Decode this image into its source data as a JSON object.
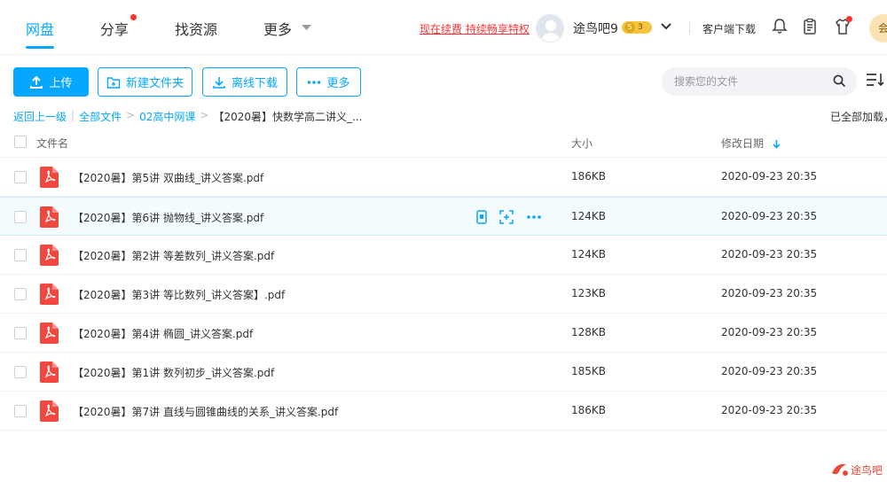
{
  "nav": {
    "tabs": [
      {
        "label": "网盘"
      },
      {
        "label": "分享"
      },
      {
        "label": "找资源"
      },
      {
        "label": "更多"
      }
    ],
    "renew_link": "现在续费 持续畅享特权",
    "username": "途鸟吧9",
    "level_badge": "5",
    "level_count": "3",
    "client_download": "客户端下载",
    "vip_initial": "会"
  },
  "toolbar": {
    "upload_label": "上传",
    "new_folder_label": "新建文件夹",
    "offline_download_label": "离线下载",
    "more_label": "更多",
    "search_placeholder": "搜索您的文件"
  },
  "breadcrumb": {
    "back": "返回上一级",
    "items": [
      "全部文件",
      "02高中网课",
      "【2020暑】快数学高二讲义_..."
    ],
    "status": "已全部加载，"
  },
  "table": {
    "columns": {
      "name": "文件名",
      "size": "大小",
      "modified": "修改日期"
    },
    "rows": [
      {
        "name": "【2020暑】第5讲 双曲线_讲义答案.pdf",
        "size": "186KB",
        "date": "2020-09-23 20:35"
      },
      {
        "name": "【2020暑】第6讲 抛物线_讲义答案.pdf",
        "size": "124KB",
        "date": "2020-09-23 20:35"
      },
      {
        "name": "【2020暑】第2讲 等差数列_讲义答案.pdf",
        "size": "124KB",
        "date": "2020-09-23 20:35"
      },
      {
        "name": "【2020暑】第3讲 等比数列_讲义答案】.pdf",
        "size": "123KB",
        "date": "2020-09-23 20:35"
      },
      {
        "name": "【2020暑】第4讲 椭圆_讲义答案.pdf",
        "size": "128KB",
        "date": "2020-09-23 20:35"
      },
      {
        "name": "【2020暑】第1讲 数列初步_讲义答案.pdf",
        "size": "185KB",
        "date": "2020-09-23 20:35"
      },
      {
        "name": "【2020暑】第7讲 直线与圆锥曲线的关系_讲义答案.pdf",
        "size": "186KB",
        "date": "2020-09-23 20:35"
      }
    ]
  },
  "watermark": "途鸟吧",
  "colors": {
    "accent": "#06a7ff",
    "alert": "#ff3333",
    "pdf": "#f0483e"
  }
}
